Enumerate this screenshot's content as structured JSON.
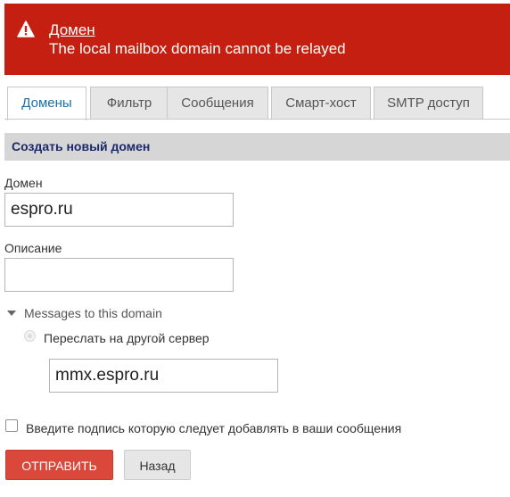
{
  "alert": {
    "title": "Домен",
    "message": "The local mailbox domain cannot be relayed",
    "icon": "warning-icon",
    "color": "#c41f10"
  },
  "tabs": [
    {
      "label": "Домены",
      "active": true
    },
    {
      "label": "Фильтр",
      "active": false
    },
    {
      "label": "Сообщения",
      "active": false
    },
    {
      "label": "Смарт-хост",
      "active": false
    },
    {
      "label": "SMTP доступ",
      "active": false
    }
  ],
  "section": {
    "title": "Создать новый домен"
  },
  "form": {
    "domain_label": "Домен",
    "domain_value": "espro.ru",
    "description_label": "Описание",
    "description_value": "",
    "messages_toggle": "Messages to this domain",
    "forward_label": "Переслать на другой сервер",
    "server_value": "mmx.espro.ru",
    "signature_label": "Введите подпись которую следует добавлять в ваши сообщения"
  },
  "buttons": {
    "submit": "ОТПРАВИТЬ",
    "back": "Назад"
  },
  "colors": {
    "accent": "#d9483b",
    "tab_active_text": "#1d6fa5",
    "section_title": "#1c2a6b"
  }
}
